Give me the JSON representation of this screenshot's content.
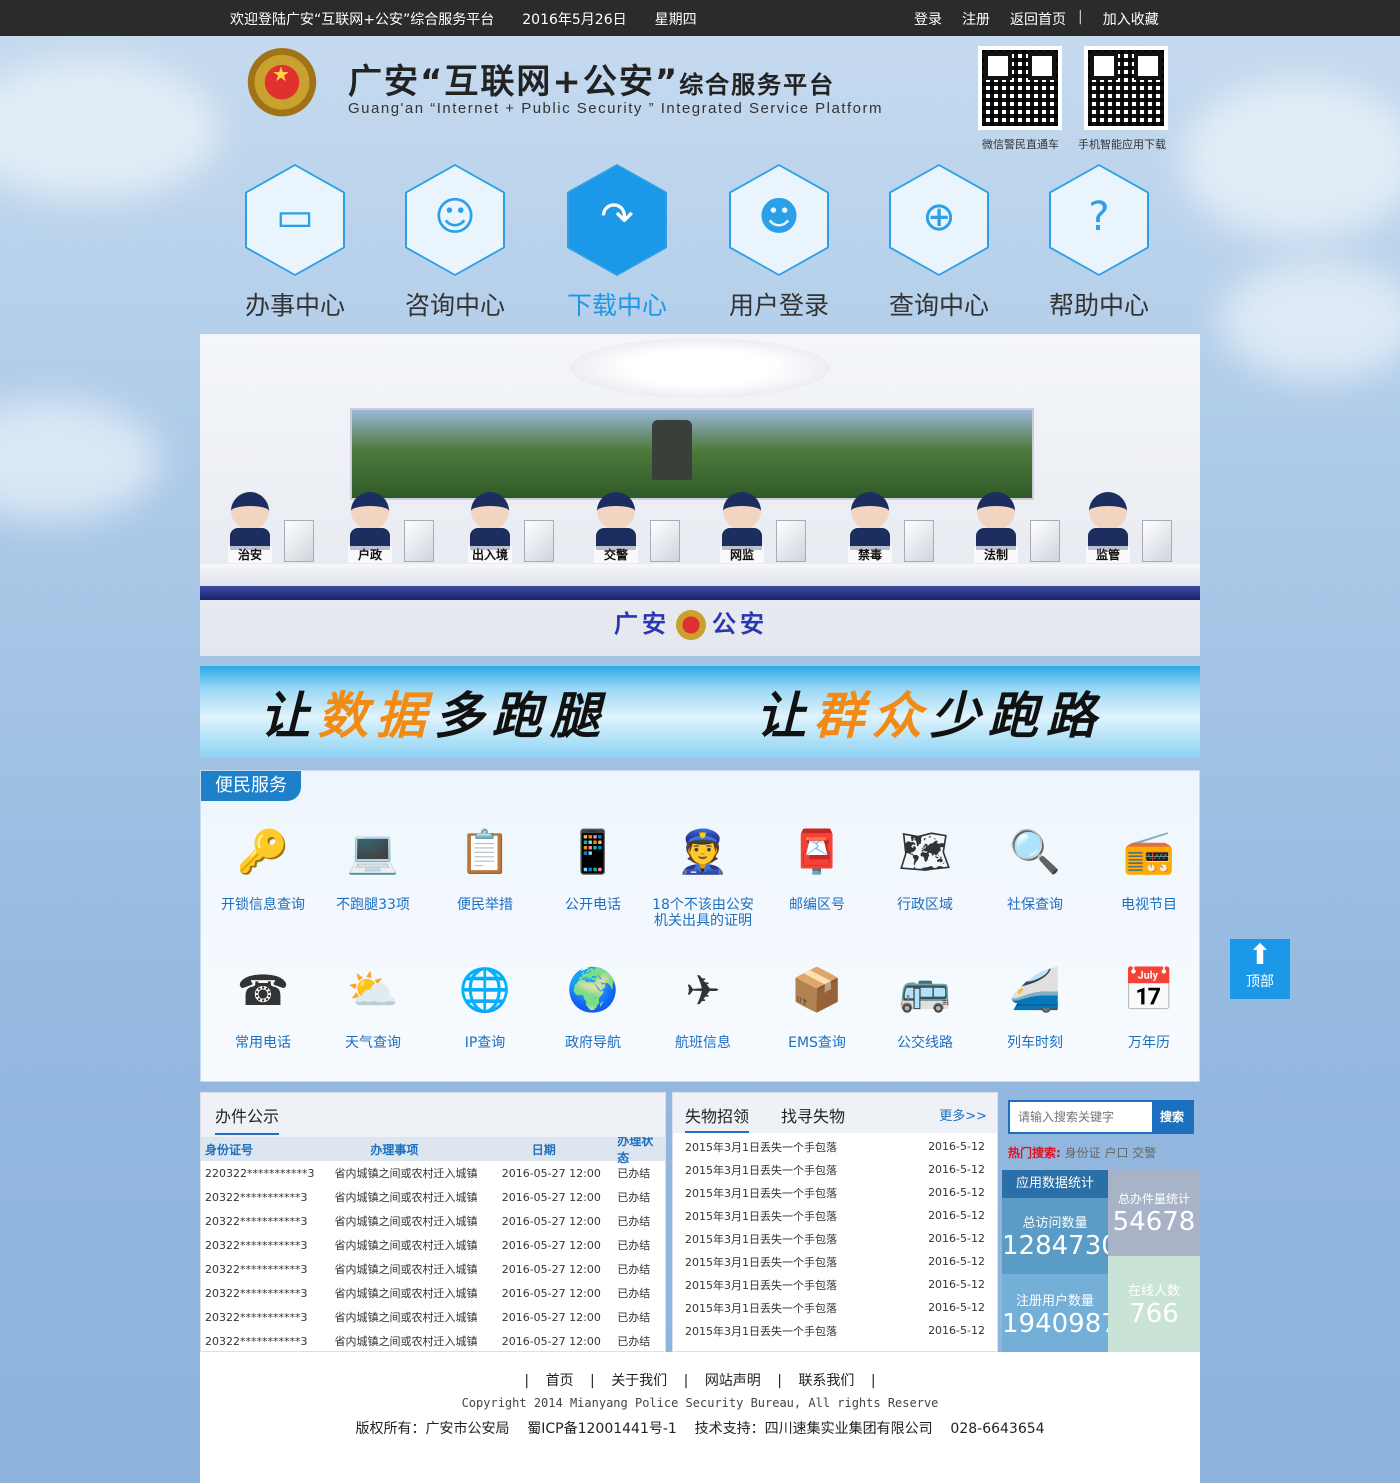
{
  "topbar": {
    "welcome": "欢迎登陆广安“互联网+公安”综合服务平台",
    "date": "2016年5月26日",
    "weekday": "星期四",
    "login": "登录",
    "register": "注册",
    "home": "返回首页",
    "sep": "|",
    "favorite": "加入收藏"
  },
  "header": {
    "title": "广安“互联网+公安”",
    "title_small": "综合服务平台",
    "subtitle": "Guang'an “Internet + Public Security ” Integrated Service Platform",
    "qr1_label": "微信警民直通车",
    "qr2_label": "手机智能应用下载"
  },
  "nav": [
    {
      "label": "办事中心",
      "icon": "monitor-icon",
      "glyph": "▭"
    },
    {
      "label": "咨询中心",
      "icon": "chat-user-icon",
      "glyph": "☺"
    },
    {
      "label": "下载中心",
      "icon": "download-arrow-icon",
      "glyph": "↷"
    },
    {
      "label": "用户登录",
      "icon": "user-icon",
      "glyph": "☻"
    },
    {
      "label": "查询中心",
      "icon": "search-zoom-icon",
      "glyph": "⊕"
    },
    {
      "label": "帮助中心",
      "icon": "help-icon",
      "glyph": "?"
    }
  ],
  "hall": {
    "officers": [
      "治安",
      "户政",
      "出入境",
      "交警",
      "网监",
      "禁毒",
      "法制",
      "监管"
    ],
    "logo_left": "广安",
    "logo_right": "公安"
  },
  "slogan": {
    "s1_a": "让",
    "s1_b": "数据",
    "s1_c": "多跑腿",
    "s2_a": "让",
    "s2_b": "群众",
    "s2_c": "少跑路"
  },
  "services": {
    "tab": "便民服务",
    "row1": [
      {
        "label": "开锁信息查询",
        "icon": "key-icon",
        "glyph": "🔑"
      },
      {
        "label": "不跑腿33项",
        "icon": "laptop-icon",
        "glyph": "💻"
      },
      {
        "label": "便民举措",
        "icon": "clipboard-icon",
        "glyph": "📋"
      },
      {
        "label": "公开电话",
        "icon": "phone-icon",
        "glyph": "📱"
      },
      {
        "label": "18个不该由公安机关出具的证明",
        "icon": "police-icon",
        "glyph": "👮"
      },
      {
        "label": "邮编区号",
        "icon": "mailbox-icon",
        "glyph": "📮"
      },
      {
        "label": "行政区域",
        "icon": "map-icon",
        "glyph": "🗺"
      },
      {
        "label": "社保查询",
        "icon": "magnifier-icon",
        "glyph": "🔍"
      },
      {
        "label": "电视节目",
        "icon": "radio-icon",
        "glyph": "📻"
      }
    ],
    "row2": [
      {
        "label": "常用电话",
        "icon": "telephone-icon",
        "glyph": "☎"
      },
      {
        "label": "天气查询",
        "icon": "weather-icon",
        "glyph": "⛅"
      },
      {
        "label": "IP查询",
        "icon": "globe-icon",
        "glyph": "🌐"
      },
      {
        "label": "政府导航",
        "icon": "globe-stand-icon",
        "glyph": "🌍"
      },
      {
        "label": "航班信息",
        "icon": "plane-icon",
        "glyph": "✈"
      },
      {
        "label": "EMS查询",
        "icon": "ems-icon",
        "glyph": "📦"
      },
      {
        "label": "公交线路",
        "icon": "bus-icon",
        "glyph": "🚌"
      },
      {
        "label": "列车时刻",
        "icon": "train-icon",
        "glyph": "🚄"
      },
      {
        "label": "万年历",
        "icon": "calendar-icon",
        "glyph": "📅"
      }
    ]
  },
  "cases": {
    "title": "办件公示",
    "headers": [
      "身份证号",
      "办理事项",
      "日期",
      "办理状态"
    ],
    "rows": [
      [
        "220322***********3",
        "省内城镇之间或农村迁入城镇",
        "2016-05-27 12:00",
        "已办结"
      ],
      [
        "20322***********3",
        "省内城镇之间或农村迁入城镇",
        "2016-05-27 12:00",
        "已办结"
      ],
      [
        "20322***********3",
        "省内城镇之间或农村迁入城镇",
        "2016-05-27 12:00",
        "已办结"
      ],
      [
        "20322***********3",
        "省内城镇之间或农村迁入城镇",
        "2016-05-27 12:00",
        "已办结"
      ],
      [
        "20322***********3",
        "省内城镇之间或农村迁入城镇",
        "2016-05-27 12:00",
        "已办结"
      ],
      [
        "20322***********3",
        "省内城镇之间或农村迁入城镇",
        "2016-05-27 12:00",
        "已办结"
      ],
      [
        "20322***********3",
        "省内城镇之间或农村迁入城镇",
        "2016-05-27 12:00",
        "已办结"
      ],
      [
        "20322***********3",
        "省内城镇之间或农村迁入城镇",
        "2016-05-27 12:00",
        "已办结"
      ]
    ]
  },
  "lost": {
    "tab1": "失物招领",
    "tab2": "找寻失物",
    "more": "更多>>",
    "rows": [
      [
        "2015年3月1日丢失一个手包落",
        "2016-5-12"
      ],
      [
        "2015年3月1日丢失一个手包落",
        "2016-5-12"
      ],
      [
        "2015年3月1日丢失一个手包落",
        "2016-5-12"
      ],
      [
        "2015年3月1日丢失一个手包落",
        "2016-5-12"
      ],
      [
        "2015年3月1日丢失一个手包落",
        "2016-5-12"
      ],
      [
        "2015年3月1日丢失一个手包落",
        "2016-5-12"
      ],
      [
        "2015年3月1日丢失一个手包落",
        "2016-5-12"
      ],
      [
        "2015年3月1日丢失一个手包落",
        "2016-5-12"
      ],
      [
        "2015年3月1日丢失一个手包落",
        "2016-5-12"
      ]
    ]
  },
  "search": {
    "placeholder": "请输入搜索关键字",
    "button": "搜索",
    "hot_label": "热门搜索:",
    "hot_terms": "身份证 户口 交警"
  },
  "stats": {
    "title": "应用数据统计",
    "visits_label": "总访问数量",
    "visits_value": "1284730",
    "cases_label": "总办件量统计",
    "cases_value": "54678",
    "users_label": "注册用户数量",
    "users_value": "1940987",
    "online_label": "在线人数",
    "online_value": "766",
    "colors": {
      "visits": "#5a9cc6",
      "cases": "#a9b3c8",
      "users": "#74afd8",
      "online": "#c9e3d6"
    }
  },
  "footer": {
    "links": [
      "首页",
      "关于我们",
      "网站声明",
      "联系我们"
    ],
    "sep": "|",
    "copyright": "Copyright 2014 Mianyang Police Security Bureau, All rights Reserve",
    "rights": "版权所有：广安市公安局    蜀ICP备12001441号-1    技术支持：四川速集实业集团有限公司    028-6643654"
  },
  "totop": {
    "label": "顶部",
    "icon": "up-arrow-icon"
  }
}
